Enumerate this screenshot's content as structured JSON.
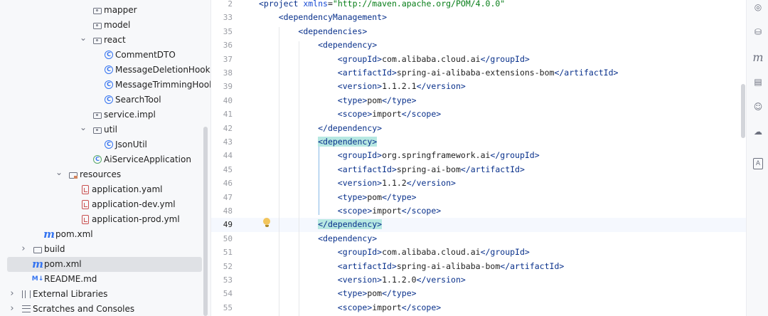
{
  "project_tree": [
    {
      "label": "mapper",
      "icon": "package-folder-icon",
      "chevron": ""
    },
    {
      "label": "model",
      "icon": "package-folder-icon",
      "chevron": ""
    },
    {
      "label": "react",
      "icon": "package-folder-icon",
      "chevron": "v"
    },
    {
      "label": "CommentDTO",
      "icon": "java-class-icon",
      "chevron": ""
    },
    {
      "label": "MessageDeletionHook",
      "icon": "java-class-icon",
      "chevron": ""
    },
    {
      "label": "MessageTrimmingHook",
      "icon": "java-class-icon",
      "chevron": ""
    },
    {
      "label": "SearchTool",
      "icon": "java-class-icon",
      "chevron": ""
    },
    {
      "label": "service.impl",
      "icon": "package-folder-icon",
      "chevron": ""
    },
    {
      "label": "util",
      "icon": "package-folder-icon",
      "chevron": "v"
    },
    {
      "label": "JsonUtil",
      "icon": "java-class-icon",
      "chevron": ""
    },
    {
      "label": "AiServiceApplication",
      "icon": "spring-app-icon",
      "chevron": ""
    },
    {
      "label": "resources",
      "icon": "resources-folder-icon",
      "chevron": "v"
    },
    {
      "label": "application.yaml",
      "icon": "yaml-file-icon",
      "chevron": ""
    },
    {
      "label": "application-dev.yml",
      "icon": "yaml-file-icon",
      "chevron": ""
    },
    {
      "label": "application-prod.yml",
      "icon": "yaml-file-icon",
      "chevron": ""
    },
    {
      "label": "pom.xml",
      "icon": "maven-icon",
      "chevron": ""
    },
    {
      "label": "build",
      "icon": "folder-icon",
      "chevron": ">"
    },
    {
      "label": "pom.xml",
      "icon": "maven-icon",
      "chevron": "",
      "selected": true
    },
    {
      "label": "README.md",
      "icon": "markdown-icon",
      "chevron": ""
    },
    {
      "label": "External Libraries",
      "icon": "libraries-icon",
      "chevron": ">"
    },
    {
      "label": "Scratches and Consoles",
      "icon": "scratches-icon",
      "chevron": ">"
    }
  ],
  "editor": {
    "lines": [
      {
        "num": "2",
        "text": "<project xmlns=\"http://maven.apache.org/POM/4.0.0\""
      },
      {
        "num": "33",
        "text": "    <dependencyManagement>"
      },
      {
        "num": "35",
        "text": "        <dependencies>"
      },
      {
        "num": "36",
        "text": "            <dependency>"
      },
      {
        "num": "37",
        "text": "                <groupId>com.alibaba.cloud.ai</groupId>"
      },
      {
        "num": "38",
        "text": "                <artifactId>spring-ai-alibaba-extensions-bom</artifactId>"
      },
      {
        "num": "39",
        "text": "                <version>1.1.2.1</version>"
      },
      {
        "num": "40",
        "text": "                <type>pom</type>"
      },
      {
        "num": "41",
        "text": "                <scope>import</scope>"
      },
      {
        "num": "42",
        "text": "            </dependency>"
      },
      {
        "num": "43",
        "text": "            <dependency>"
      },
      {
        "num": "44",
        "text": "                <groupId>org.springframework.ai</groupId>"
      },
      {
        "num": "45",
        "text": "                <artifactId>spring-ai-bom</artifactId>"
      },
      {
        "num": "46",
        "text": "                <version>1.1.2</version>"
      },
      {
        "num": "47",
        "text": "                <type>pom</type>"
      },
      {
        "num": "48",
        "text": "                <scope>import</scope>"
      },
      {
        "num": "49",
        "text": "            </dependency>",
        "current": true
      },
      {
        "num": "50",
        "text": "            <dependency>"
      },
      {
        "num": "51",
        "text": "                <groupId>com.alibaba.cloud.ai</groupId>"
      },
      {
        "num": "52",
        "text": "                <artifactId>spring-ai-alibaba-bom</artifactId>"
      },
      {
        "num": "53",
        "text": "                <version>1.1.2.0</version>"
      },
      {
        "num": "54",
        "text": "                <type>pom</type>"
      },
      {
        "num": "55",
        "text": "                <scope>import</scope>"
      }
    ],
    "highlighted_lines": [
      "43",
      "49"
    ]
  },
  "right_toolbar": [
    "ai-assistant-icon",
    "database-icon",
    "maven-icon",
    "notifications-icon",
    "copilot-icon",
    "deploy-icon",
    "text-icon"
  ],
  "colors": {
    "tag": "#08308b",
    "attr": "#174ad4",
    "string": "#067d17",
    "match_highlight": "#b7e8e2",
    "selection": "#dfe1e5"
  }
}
